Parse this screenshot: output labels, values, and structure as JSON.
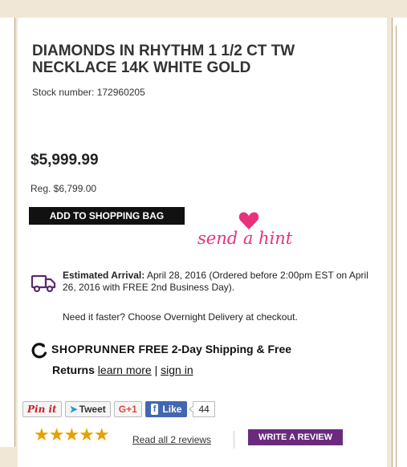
{
  "product": {
    "title": "DIAMONDS IN RHYTHM 1 1/2 CT TW NECKLACE 14K WHITE GOLD",
    "stock_number": "Stock number: 172960205",
    "price": "$5,999.99",
    "regular_price": "Reg.  $6,799.00"
  },
  "actions": {
    "add_to_bag": "ADD TO SHOPPING BAG",
    "send_hint": "send a hint"
  },
  "delivery": {
    "label": "Estimated Arrival:",
    "details": " April 28, 2016 (Ordered before 2:00pm EST on April 26, 2016 with FREE 2nd Business Day).",
    "faster": "Need it faster? Choose Overnight Delivery at checkout."
  },
  "shoprunner": {
    "brand": "SHOPRUNNER",
    "offer_line1": "FREE 2-Day Shipping & Free",
    "offer_line2": "Returns",
    "learn_more": "learn more",
    "separator": "|",
    "sign_in": "sign in"
  },
  "social": {
    "pinit": "Pin it",
    "tweet": "Tweet",
    "gplus": "G+1",
    "fb_like": "Like",
    "fb_count": "44"
  },
  "reviews": {
    "stars": "★★★★★",
    "rating": 5,
    "read_all": "Read all 2 reviews",
    "write": "WRITE A REVIEW"
  },
  "colors": {
    "background": "#f0e7d6",
    "hint_pink": "#e8327e",
    "star_gold": "#e6a100",
    "review_purple": "#6b2a7d",
    "facebook_blue": "#4267b2"
  }
}
